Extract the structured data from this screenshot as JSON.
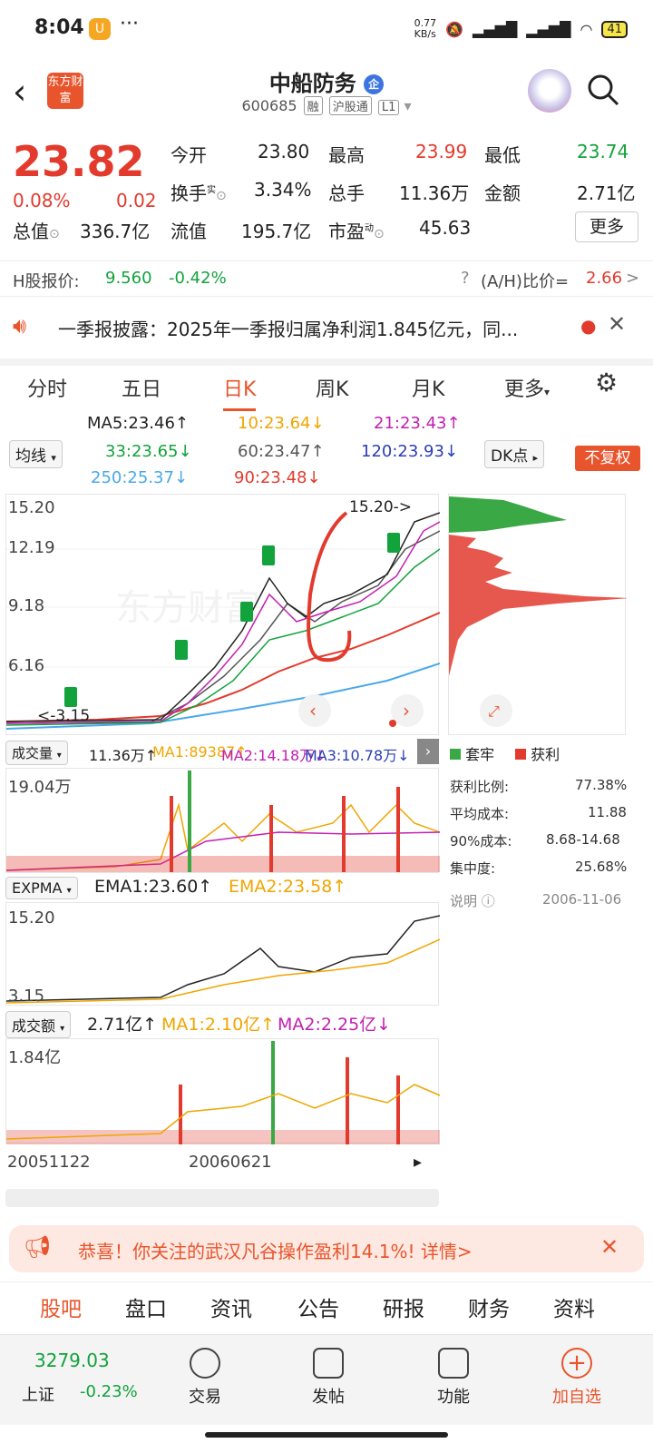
{
  "status": {
    "time": "8:04",
    "app_badge": "U",
    "dots": "···",
    "net_speed": "0.77\nKB/s",
    "battery": "41"
  },
  "header": {
    "title": "中船防务",
    "corp_tag": "企",
    "code": "600685",
    "tags": [
      "融",
      "沪股通",
      "L1"
    ],
    "logo_text": "东方财富"
  },
  "quote": {
    "price": "23.82",
    "change_pct": "0.08%",
    "change": "0.02",
    "fields": [
      {
        "label": "今开",
        "value": "23.80",
        "color": "normal"
      },
      {
        "label": "最高",
        "value": "23.99",
        "color": "red"
      },
      {
        "label": "最低",
        "value": "23.74",
        "color": "green"
      },
      {
        "label": "换手",
        "sup": "实",
        "value": "3.34%",
        "color": "normal"
      },
      {
        "label": "总手",
        "value": "11.36万",
        "color": "normal"
      },
      {
        "label": "金额",
        "value": "2.71亿",
        "color": "normal"
      },
      {
        "label": "总值",
        "value": "336.7亿",
        "color": "normal"
      },
      {
        "label": "流值",
        "value": "195.7亿",
        "color": "normal"
      },
      {
        "label": "市盈",
        "sup": "动",
        "value": "45.63",
        "color": "normal"
      }
    ],
    "more": "更多"
  },
  "hshare": {
    "label": "H股报价:",
    "price": "9.560",
    "pct": "-0.42%",
    "ratio_label": "(A/H)比价=",
    "ratio": "2.66",
    "arrow": ">"
  },
  "notice": {
    "text": "一季报披露：2025年一季报归属净利润1.845亿元，同..."
  },
  "tabs": [
    "分时",
    "五日",
    "日K",
    "周K",
    "月K",
    "更多"
  ],
  "active_tab": "日K",
  "ma": {
    "selector": "均线",
    "items": [
      {
        "text": "MA5:23.46↑",
        "color": "#222"
      },
      {
        "text": "10:23.64↓",
        "color": "#f0a500"
      },
      {
        "text": "21:23.43↑",
        "color": "#c21fb2"
      },
      {
        "text": "33:23.65↓",
        "color": "#12a33c"
      },
      {
        "text": "60:23.47↑",
        "color": "#555"
      },
      {
        "text": "120:23.93↓",
        "color": "#2a3fb5"
      },
      {
        "text": "250:25.37↓",
        "color": "#4aa8e8"
      },
      {
        "text": "90:23.48↓",
        "color": "#e23b2e"
      }
    ],
    "dk": "DK点",
    "fq": "不复权"
  },
  "kchart": {
    "y_labels": [
      "15.20",
      "12.19",
      "9.18",
      "6.16"
    ],
    "max_label": "15.20->",
    "min_label": "<-3.15",
    "watermark": "东方财富"
  },
  "chips": {
    "legend": [
      "套牢",
      "获利"
    ],
    "stats": [
      {
        "label": "获利比例:",
        "value": "77.38%"
      },
      {
        "label": "平均成本:",
        "value": "11.88"
      },
      {
        "label": "90%成本:",
        "value": "8.68-14.68"
      },
      {
        "label": "集中度:",
        "value": "25.68%"
      }
    ],
    "note": "说明",
    "date": "2006-11-06"
  },
  "volume": {
    "selector": "成交量",
    "text": "11.36万↑",
    "ma1": "MA1:89387↑",
    "ma2": "MA2:14.18万↓",
    "ma3": "MA3:10.78万↓",
    "ymax": "19.04万"
  },
  "expma": {
    "selector": "EXPMA",
    "ema1": "EMA1:23.60↑",
    "ema2": "EMA2:23.58↑",
    "ytop": "15.20",
    "ybot": "3.15"
  },
  "amount": {
    "selector": "成交额",
    "text": "2.71亿↑",
    "ma1": "MA1:2.10亿↑",
    "ma2": "MA2:2.25亿↓",
    "ymax": "1.84亿",
    "dates": [
      "20051122",
      "20060621"
    ]
  },
  "toast": {
    "text": "恭喜！你关注的武汉凡谷操作盈利14.1%! 详情>"
  },
  "bottom_tabs": [
    "股吧",
    "盘口",
    "资讯",
    "公告",
    "研报",
    "财务",
    "资料"
  ],
  "footer": {
    "index_value": "3279.03",
    "index_name": "上证",
    "index_pct": "-0.23%",
    "items": [
      "交易",
      "发帖",
      "功能",
      "加自选"
    ]
  }
}
